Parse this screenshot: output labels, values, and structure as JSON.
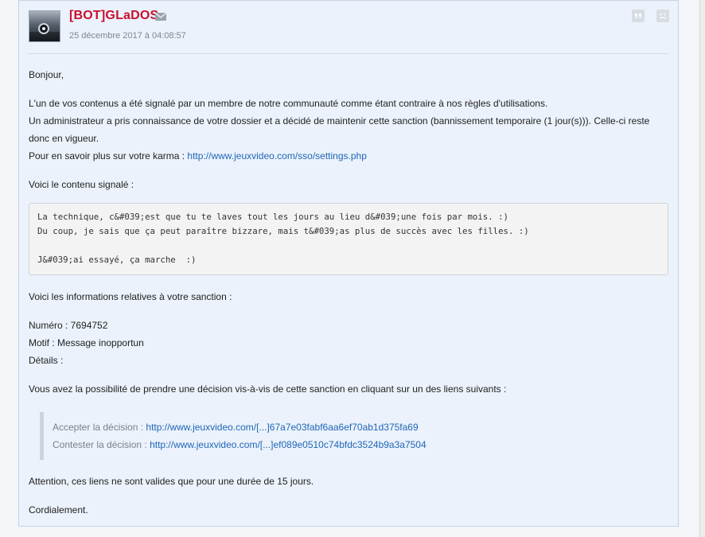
{
  "post": {
    "author": "[BOT]GLaDOS",
    "date": "25 décembre 2017 à 04:08:57",
    "greeting": "Bonjour,",
    "report_line_1": "L'un de vos contenus a été signalé par un membre de notre communauté comme étant contraire à nos règles d'utilisations.",
    "report_line_2": "Un administrateur a pris connaissance de votre dossier et a décidé de maintenir cette sanction (bannissement temporaire (1 jour(s))). Celle-ci reste donc en vigueur.",
    "karma_prefix": "Pour en savoir plus sur votre karma : ",
    "karma_link": "http://www.jeuxvideo.com/sso/settings.php",
    "reported_intro": "Voici le contenu signalé :",
    "reported_content": "La technique, c&#039;est que tu te laves tout les jours au lieu d&#039;une fois par mois. :)\nDu coup, je sais que ça peut paraître bizzare, mais t&#039;as plus de succès avec les filles. :)\n\nJ&#039;ai essayé, ça marche  :)",
    "sanction_intro": "Voici les informations relatives à votre sanction :",
    "numero_line": "Numéro : 7694752",
    "motif_line": "Motif : Message inopportun",
    "details_line": "Détails :",
    "decision_intro": "Vous avez la possibilité de prendre une décision vis-à-vis de cette sanction en cliquant sur un des liens suivants :",
    "accept_label": "Accepter la décision : ",
    "accept_link": "http://www.jeuxvideo.com/[...]67a7e03fabf6aa6ef70ab1d375fa69",
    "contest_label": "Contester la décision : ",
    "contest_link": "http://www.jeuxvideo.com/[...]ef089e0510c74bfdc3524b9a3a7504",
    "validity_note": "Attention, ces liens ne sont valides que pour une durée de 15 jours.",
    "closing": "Cordialement."
  },
  "icons": {
    "mail": "envelope-icon",
    "quote": "quote-icon",
    "report": "report-icon"
  },
  "colors": {
    "author": "#c8102e",
    "link": "#1f66b8",
    "card_background": "#ebf2fb"
  }
}
